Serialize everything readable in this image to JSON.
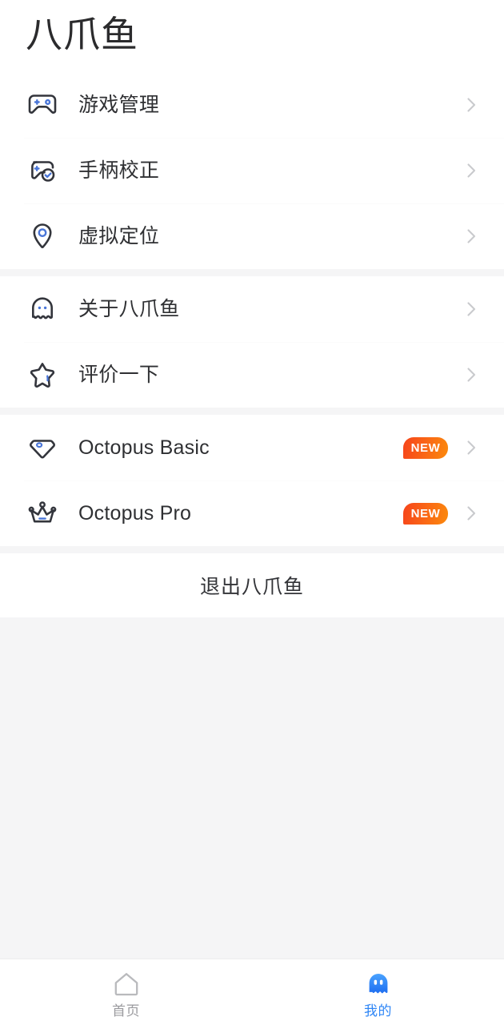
{
  "header": {
    "title": "八爪鱼"
  },
  "colors": {
    "accent_blue": "#4a76d8",
    "icon_outline": "#33353c",
    "active_tab": "#2f86f6",
    "badge_gradient_start": "#f6441b",
    "badge_gradient_end": "#fb8a0c",
    "page_background": "#f5f5f6",
    "card_background": "#ffffff",
    "chevron": "#c9cacd"
  },
  "groups": [
    {
      "name": "tools",
      "items": [
        {
          "icon": "gamepad-icon",
          "label": "游戏管理",
          "badge": null,
          "chevron": "chevron-right-icon"
        },
        {
          "icon": "controller-check-icon",
          "label": "手柄校正",
          "badge": null,
          "chevron": "chevron-right-icon"
        },
        {
          "icon": "location-pin-icon",
          "label": "虚拟定位",
          "badge": null,
          "chevron": "chevron-right-icon"
        }
      ]
    },
    {
      "name": "info",
      "items": [
        {
          "icon": "octopus-ghost-icon",
          "label": "关于八爪鱼",
          "badge": null,
          "chevron": "chevron-right-icon"
        },
        {
          "icon": "star-icon",
          "label": "评价一下",
          "badge": null,
          "chevron": "chevron-right-icon"
        }
      ]
    },
    {
      "name": "products",
      "items": [
        {
          "icon": "diamond-icon",
          "label": "Octopus Basic",
          "badge": "NEW",
          "chevron": "chevron-right-icon"
        },
        {
          "icon": "crown-icon",
          "label": "Octopus Pro",
          "badge": "NEW",
          "chevron": "chevron-right-icon"
        }
      ]
    }
  ],
  "logout": {
    "label": "退出八爪鱼"
  },
  "tabbar": {
    "tabs": [
      {
        "icon": "home-icon",
        "label": "首页",
        "active": false
      },
      {
        "icon": "octopus-ghost-filled-icon",
        "label": "我的",
        "active": true
      }
    ]
  }
}
